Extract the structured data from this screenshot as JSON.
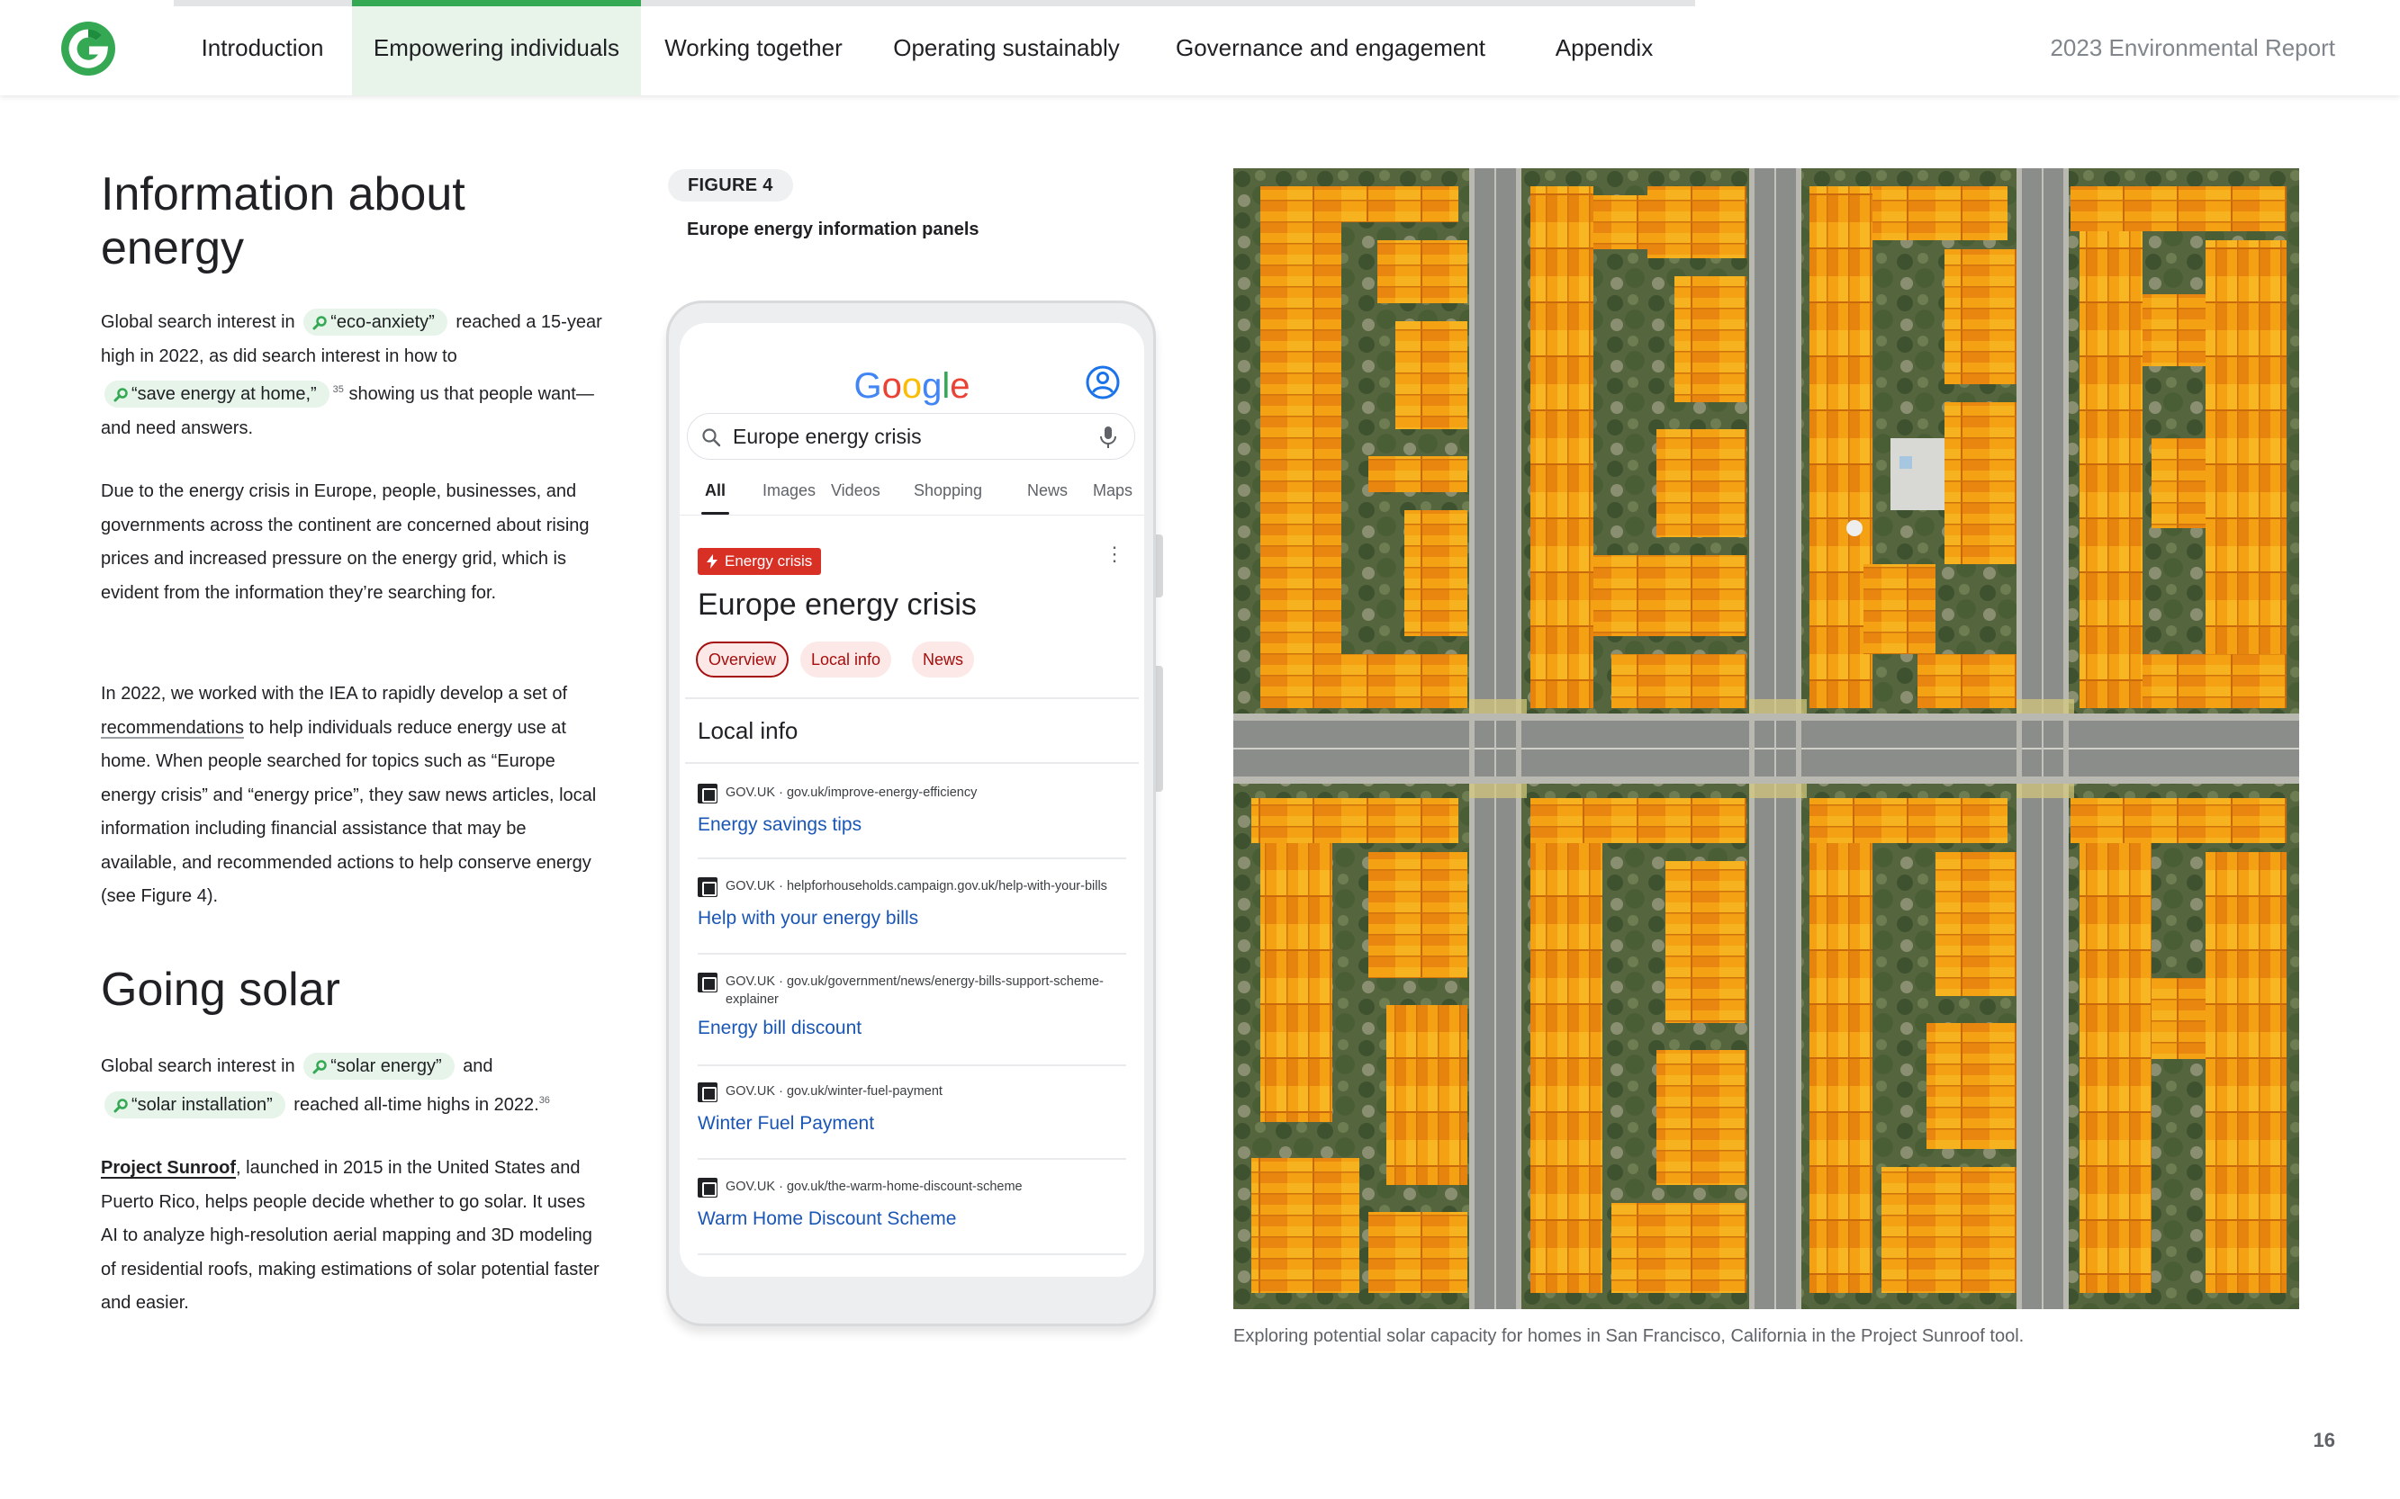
{
  "nav": {
    "tabs": [
      {
        "label": "Introduction"
      },
      {
        "label": "Empowering individuals"
      },
      {
        "label": "Working together"
      },
      {
        "label": "Operating sustainably"
      },
      {
        "label": "Governance and engagement"
      },
      {
        "label": "Appendix"
      }
    ],
    "active_tab": "Empowering individuals",
    "report_title": "2023 Environmental Report"
  },
  "energy": {
    "heading": "Information about energy",
    "p1": {
      "t1": "Global search interest in",
      "chip1": "“eco-anxiety”",
      "t2": "reached a 15-year high in 2022, as did search interest in how to",
      "chip2": "“save energy at home,”",
      "sup": "35",
      "t3": "showing us that people want—and need answers."
    },
    "p2": "Due to the energy crisis in Europe, people, businesses, and governments across the continent are concerned about rising prices and increased pressure on the energy grid, which is evident from the information they’re searching for.",
    "p3": {
      "t1": "In 2022, we worked with the IEA to rapidly develop a set of",
      "link": "recommendations",
      "t2": "to help individuals reduce energy use at home. When people searched for topics such as “Europe energy crisis” and “energy price”, they saw news articles, local information including financial assistance that may be available, and recommended actions to help conserve energy (see Figure 4)."
    }
  },
  "solar": {
    "heading": "Going solar",
    "p1": {
      "t1": "Global search interest in",
      "chip1": "“solar energy”",
      "t2": "and",
      "chip2": "“solar installation”",
      "t3": "reached all-time highs in 2022.",
      "sup": "36"
    },
    "p2": {
      "link": "Project Sunroof",
      "t1": ", launched in 2015 in the United States and Puerto Rico, helps people decide whether to go solar. It uses AI to analyze high-resolution aerial mapping and 3D modeling of residential roofs, making estimations of solar potential faster and easier."
    }
  },
  "figure": {
    "badge": "FIGURE 4",
    "caption": "Europe energy information panels"
  },
  "phone": {
    "logo": "Google",
    "search_value": "Europe energy crisis",
    "tabs": [
      "All",
      "Images",
      "Videos",
      "Shopping",
      "News",
      "Maps"
    ],
    "active_tab": "All",
    "badge": "Energy crisis",
    "title": "Europe energy crisis",
    "pills": [
      "Overview",
      "Local info",
      "News"
    ],
    "local_heading": "Local info",
    "results": [
      {
        "source": "GOV.UK · gov.uk/improve-energy-efficiency",
        "title": "Energy savings tips"
      },
      {
        "source": "GOV.UK · helpforhouseholds.campaign.gov.uk/help-with-your-bills",
        "title": "Help with your energy bills"
      },
      {
        "source": "GOV.UK · gov.uk/government/news/energy-bills-support-scheme-explainer",
        "title": "Energy bill discount"
      },
      {
        "source": "GOV.UK · gov.uk/winter-fuel-payment",
        "title": "Winter Fuel Payment"
      },
      {
        "source": "GOV.UK · gov.uk/the-warm-home-discount-scheme",
        "title": "Warm Home Discount Scheme"
      }
    ]
  },
  "image": {
    "caption": "Exploring potential solar capacity for homes in San Francisco, California in the Project Sunroof tool."
  },
  "page_number": "16",
  "colors": {
    "accent_green": "#34a853",
    "chip_bg": "#e6f4ea",
    "link_blue": "#1a56b6",
    "crisis_red": "#d93025"
  }
}
